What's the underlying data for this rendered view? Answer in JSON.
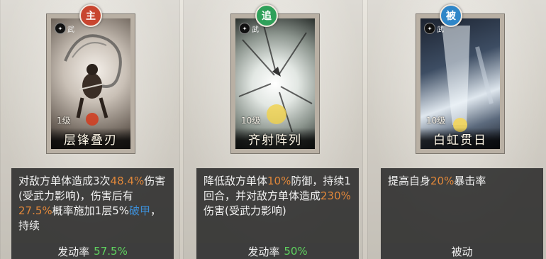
{
  "skills": [
    {
      "type_badge": "主",
      "badge_color": "#c8452f",
      "corner_tag": "武",
      "level": "1级",
      "name": "层锋叠刃",
      "desc_parts": [
        {
          "t": "对敌方单体造成3次",
          "c": ""
        },
        {
          "t": "48.4%",
          "c": "o"
        },
        {
          "t": "伤害(受武力影响)，伤害后有",
          "c": ""
        },
        {
          "t": "27.5%",
          "c": "o"
        },
        {
          "t": "概率施加1层5%",
          "c": ""
        },
        {
          "t": "破甲",
          "c": "b"
        },
        {
          "t": "，持续",
          "c": ""
        }
      ],
      "rate_label": "发动率",
      "rate_value": "57.5%"
    },
    {
      "type_badge": "追",
      "badge_color": "#2fa05a",
      "corner_tag": "武",
      "level": "10级",
      "name": "齐射阵列",
      "desc_parts": [
        {
          "t": "降低敌方单体",
          "c": ""
        },
        {
          "t": "10%",
          "c": "o"
        },
        {
          "t": "防御，持续1回合，并对敌方单体造成",
          "c": ""
        },
        {
          "t": "230%",
          "c": "o"
        },
        {
          "t": "伤害(受武力影响)",
          "c": ""
        }
      ],
      "rate_label": "发动率",
      "rate_value": "50%"
    },
    {
      "type_badge": "被",
      "badge_color": "#2f86c8",
      "corner_tag": "武",
      "level": "10级",
      "name": "白虹贯日",
      "desc_parts": [
        {
          "t": "提高自身",
          "c": ""
        },
        {
          "t": "20%",
          "c": "o"
        },
        {
          "t": "暴击率",
          "c": ""
        }
      ],
      "rate_label": "被动",
      "rate_value": ""
    }
  ]
}
